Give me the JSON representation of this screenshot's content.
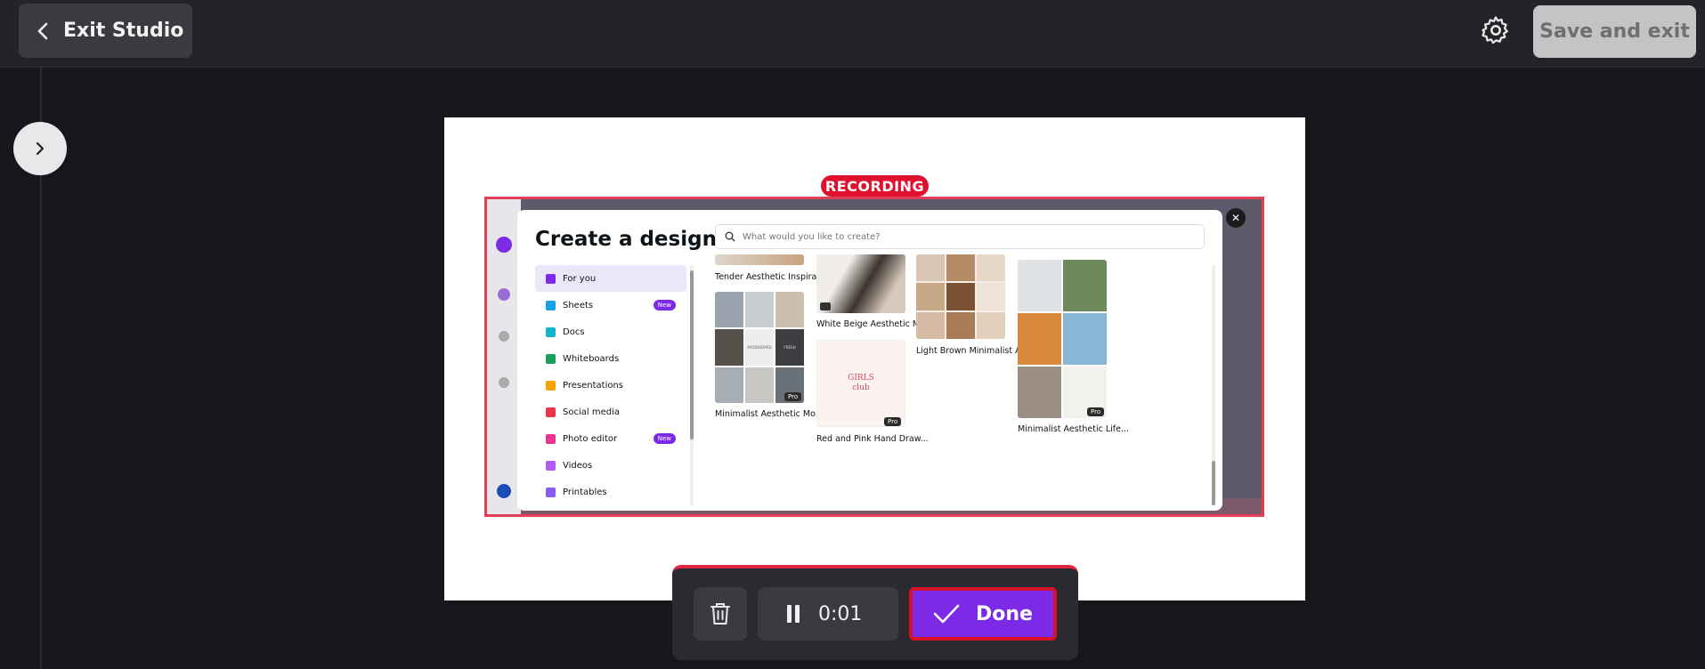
{
  "topbar": {
    "exit_label": "Exit Studio",
    "save_label": "Save and exit"
  },
  "recording": {
    "badge": "RECORDING"
  },
  "modal": {
    "title": "Create a design",
    "search_placeholder": "What would you like to create?",
    "menu": [
      {
        "label": "For you",
        "color": "#7d2ae8"
      },
      {
        "label": "Sheets",
        "color": "#1aa0e8",
        "badge": "New"
      },
      {
        "label": "Docs",
        "color": "#14b3c8"
      },
      {
        "label": "Whiteboards",
        "color": "#1a9e5c"
      },
      {
        "label": "Presentations",
        "color": "#f5a300"
      },
      {
        "label": "Social media",
        "color": "#e8354a"
      },
      {
        "label": "Photo editor",
        "color": "#e8358f",
        "badge": "New"
      },
      {
        "label": "Videos",
        "color": "#b05cf0"
      },
      {
        "label": "Printables",
        "color": "#8a5cf0"
      }
    ],
    "templates": {
      "tender": "Tender Aesthetic Inspira...",
      "white_beige": "White Beige Aesthetic Mi...",
      "light_brown": "Light Brown Minimalist A...",
      "minimalist_mo": "Minimalist Aesthetic Mo...",
      "red_pink": "Red and Pink Hand Draw...",
      "minimalist_life": "Minimalist Aesthetic Life...",
      "girls_club": "GIRLS club",
      "pro": "Pro",
      "moodboard": "MOODBOARD",
      "fresh": "FRESH"
    }
  },
  "controls": {
    "time": "0:01",
    "done_label": "Done"
  }
}
